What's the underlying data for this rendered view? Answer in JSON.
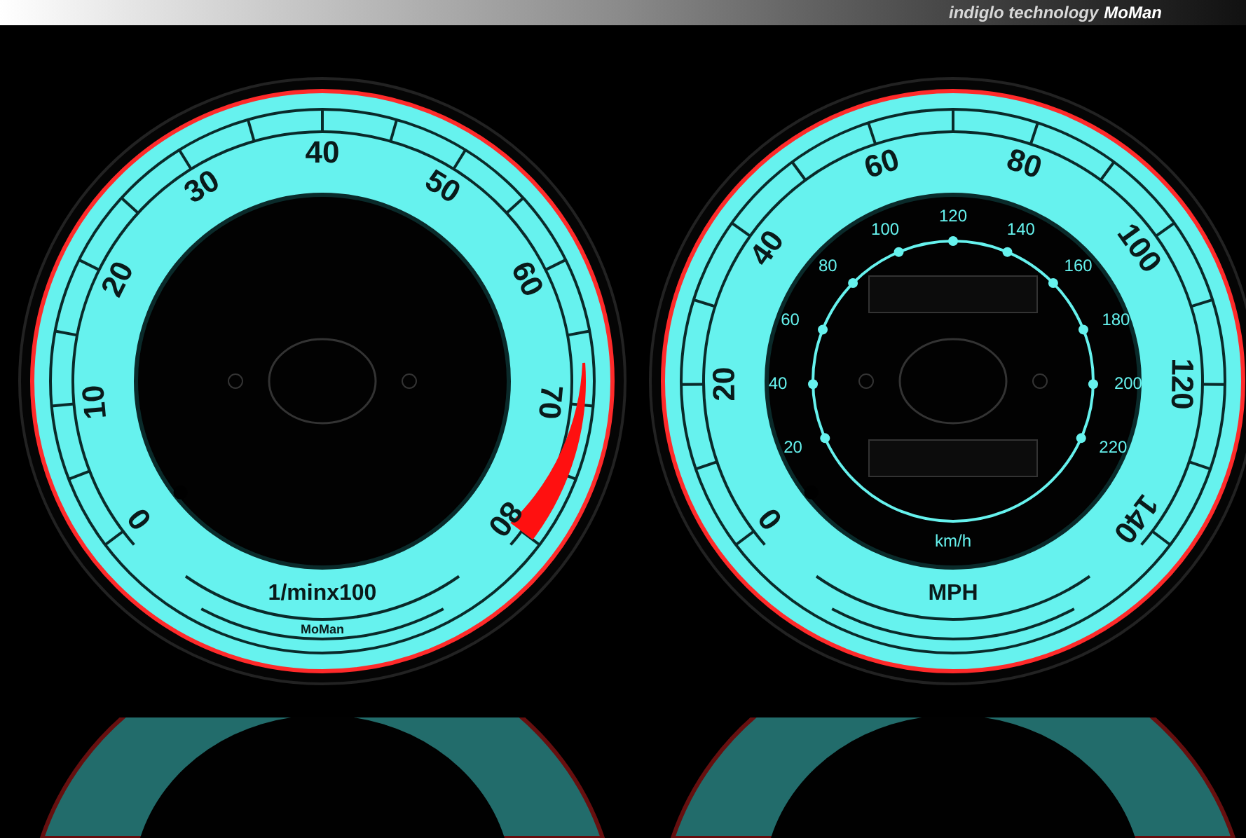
{
  "header": {
    "tagline": "indiglo technology",
    "logo": "MoMan"
  },
  "gauges": [
    {
      "kind": "tachometer",
      "labels": [
        "0",
        "10",
        "20",
        "30",
        "40",
        "50",
        "60",
        "70",
        "80"
      ],
      "unit": "1/minx100",
      "logo": "MoMan"
    },
    {
      "kind": "speedometer",
      "labels": [
        "0",
        "20",
        "40",
        "60",
        "80",
        "100",
        "120",
        "140"
      ],
      "inner_labels": [
        "20",
        "40",
        "60",
        "80",
        "100",
        "120",
        "140",
        "160",
        "180",
        "200",
        "220"
      ],
      "inner_unit": "km/h",
      "unit": "MPH"
    }
  ]
}
